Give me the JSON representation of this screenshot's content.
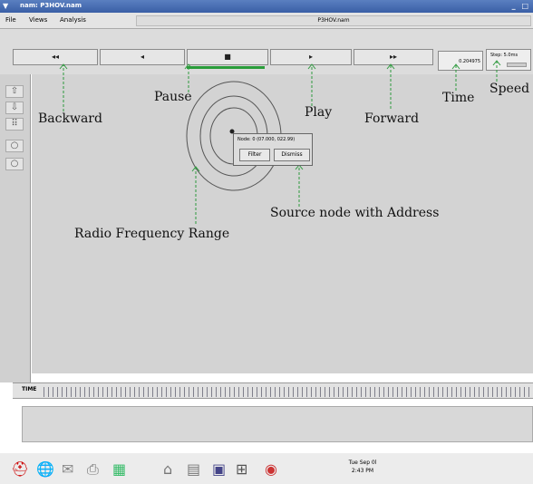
{
  "window": {
    "title": "nam: P3HOV.nam",
    "controls": "_ □"
  },
  "menu": {
    "items": [
      "File",
      "Views",
      "Analysis"
    ],
    "file_label": "P3HOV.nam"
  },
  "toolbar": {
    "backward": "◂◂",
    "step_back": "◂",
    "stop": "■",
    "play": "▸",
    "forward": "▸▸",
    "time_value": "0.204975",
    "step_label": "Step: 5.0ms"
  },
  "annotations": {
    "backward": "Backward",
    "pause": "Pause",
    "play": "Play",
    "forward": "Forward",
    "time": "Time",
    "speed": "Speed",
    "source": "Source node with Address",
    "radio": "Radio Frequency Range"
  },
  "popup": {
    "header": "Node: 0 (07.000, 022.99)",
    "filter": "Filter",
    "dismiss": "Dismiss"
  },
  "timeline": {
    "label": "TIME"
  },
  "taskbar": {
    "clock_day": "Tue Sep 0l",
    "clock_time": "2:43 PM"
  },
  "colors": {
    "annotation_line": "#2e9a3e",
    "titlebar": "#3a5fa6"
  }
}
